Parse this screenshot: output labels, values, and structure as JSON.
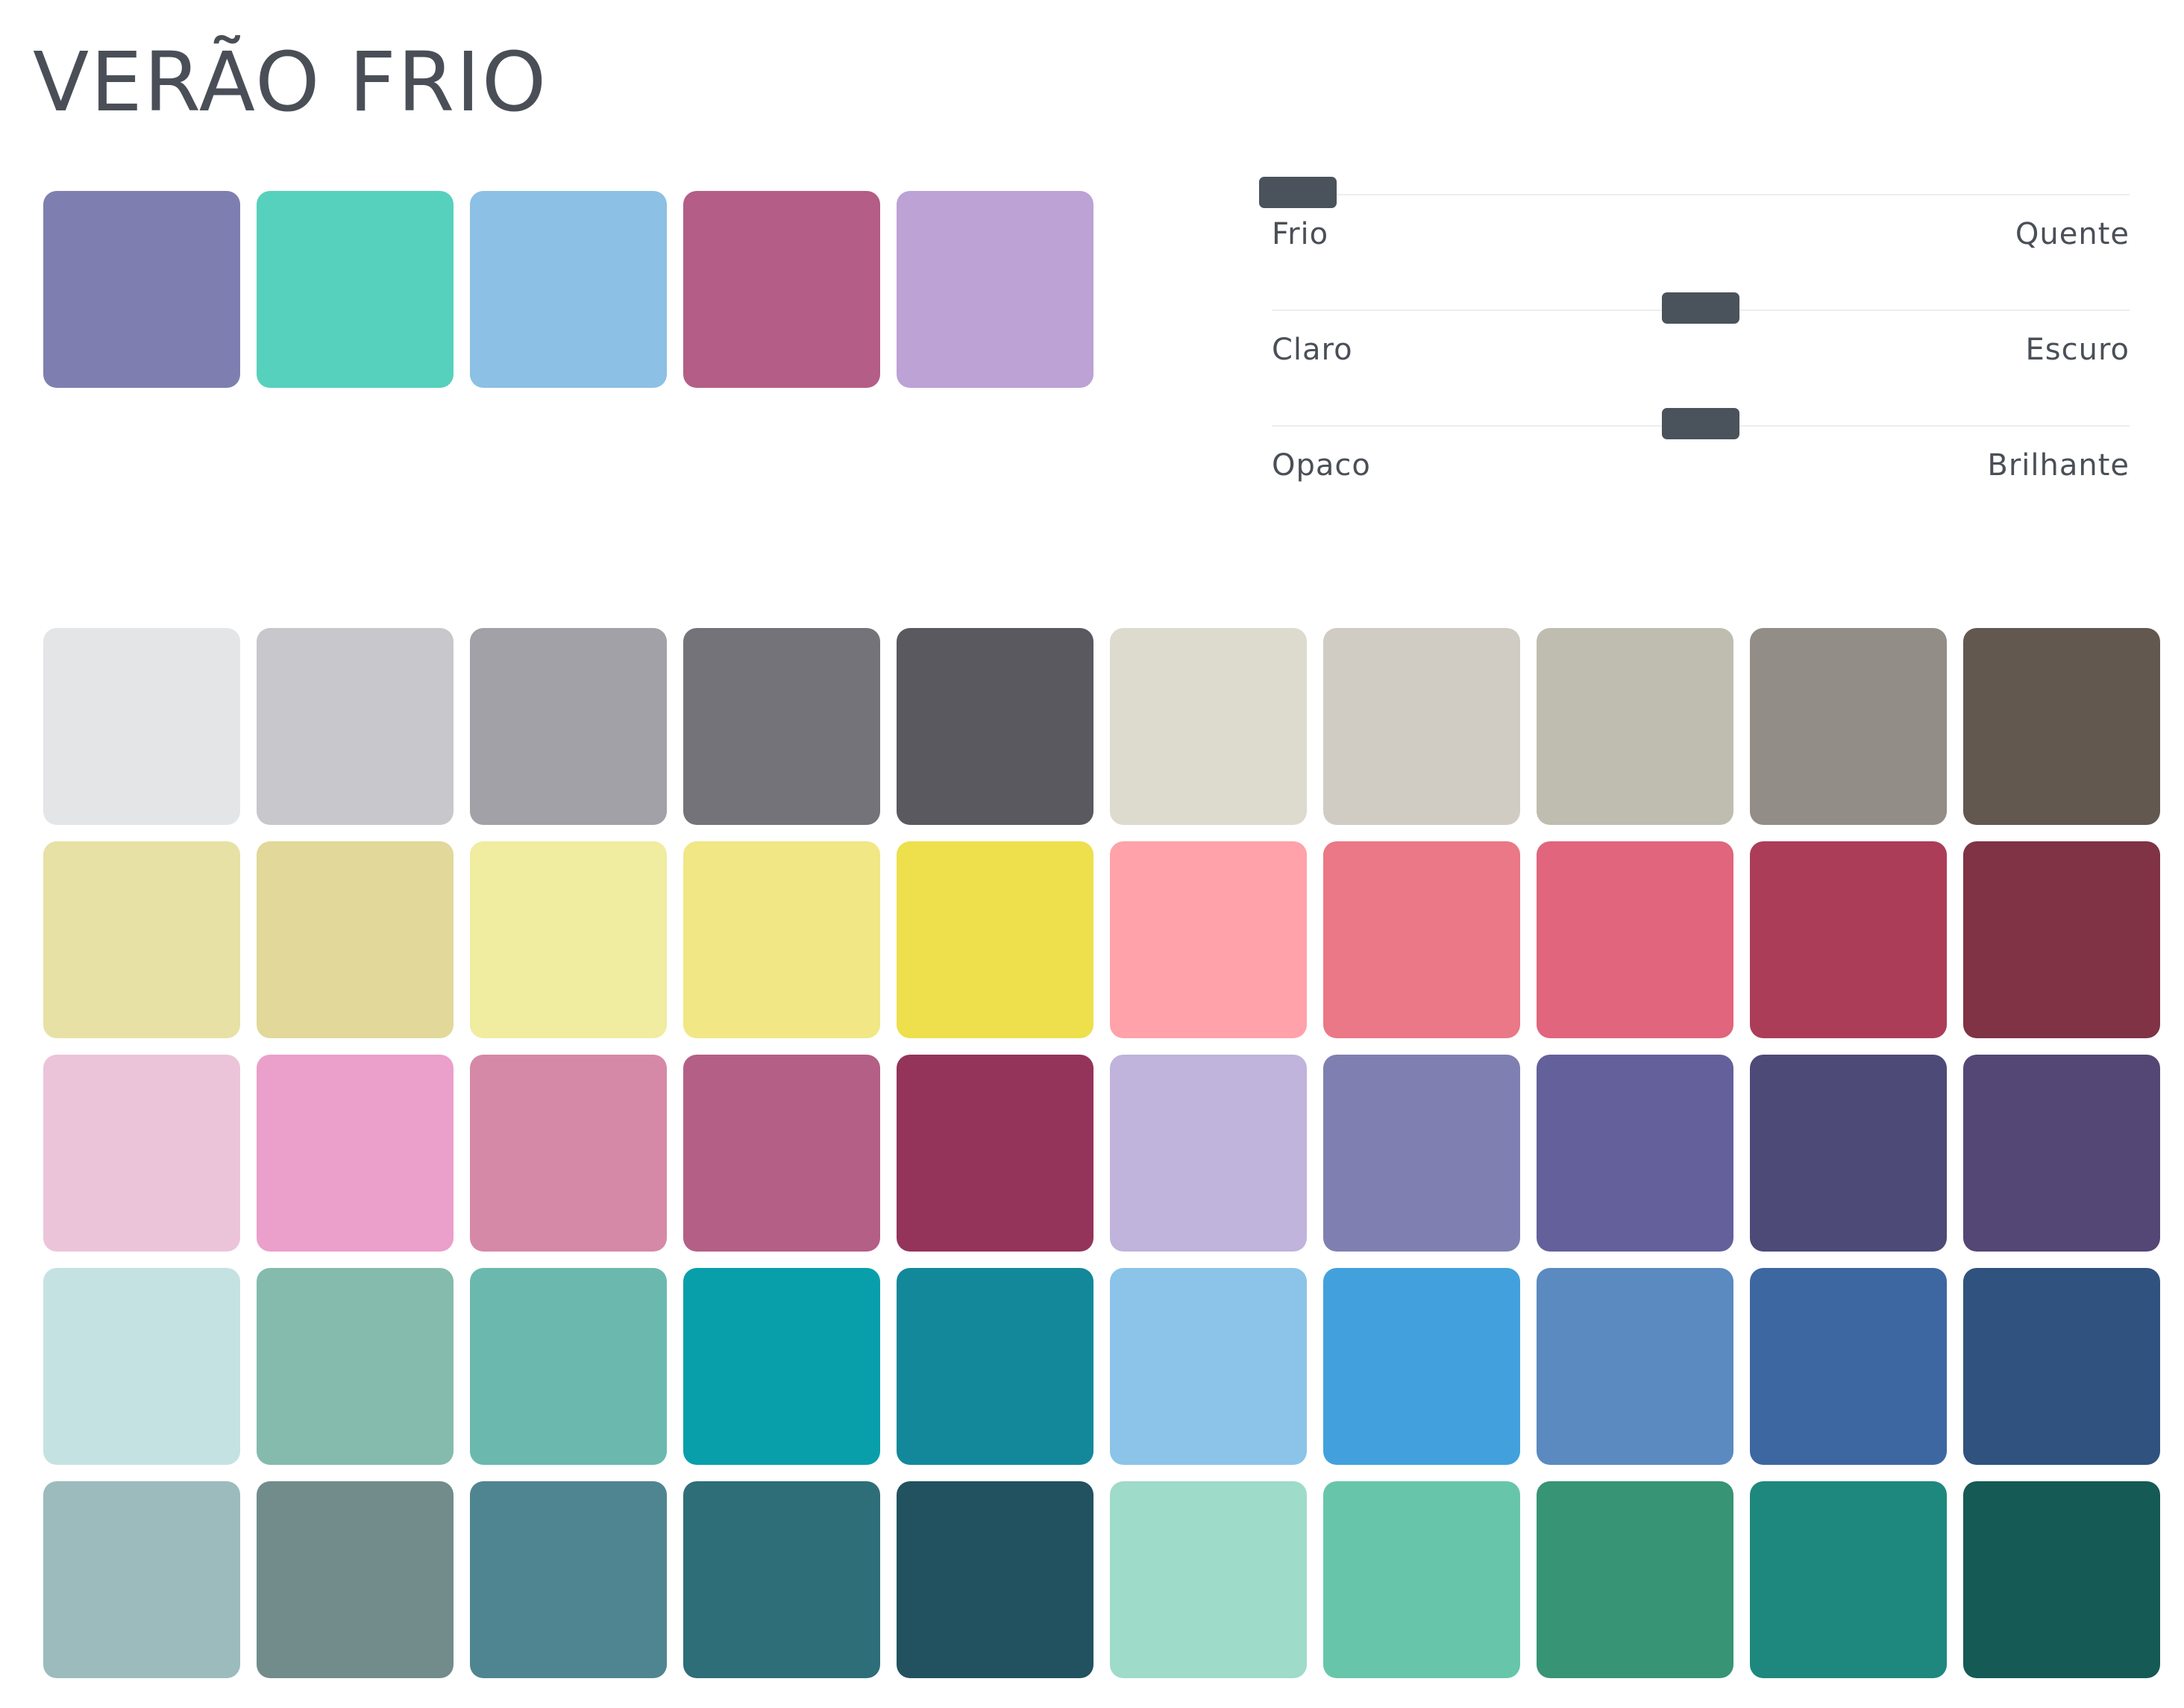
{
  "title": "VERÃO FRIO",
  "featured_colors": [
    "#7e7fb0",
    "#56d1bd",
    "#8cc0e4",
    "#b45d86",
    "#bca2d5"
  ],
  "sliders": [
    {
      "left_label": "Frio",
      "right_label": "Quente",
      "value": 0.03
    },
    {
      "left_label": "Claro",
      "right_label": "Escuro",
      "value": 0.5
    },
    {
      "left_label": "Opaco",
      "right_label": "Brilhante",
      "value": 0.5
    }
  ],
  "palette": [
    [
      "#e4e5e7",
      "#c7c7cc",
      "#a1a1a7",
      "#747379",
      "#5a595f",
      "#dddbce",
      "#d0ccc4",
      "#bfbdb0",
      "#928d86",
      "#625850"
    ],
    [
      "#e8e1a5",
      "#e1d89a",
      "#f0eca0",
      "#f1e785",
      "#ede04c",
      "#ffa2a9",
      "#ea7886",
      "#e0657d",
      "#ab3d59",
      "#7f3345"
    ],
    [
      "#ecc4da",
      "#eb9fcb",
      "#d589a7",
      "#b45f86",
      "#94345b",
      "#c0b3dc",
      "#7f80b1",
      "#64609b",
      "#4d4a78",
      "#544776"
    ],
    [
      "#c5e2e2",
      "#84bbad",
      "#6bb9ae",
      "#089fab",
      "#13889b",
      "#8bc4e8",
      "#42a1dc",
      "#5b8ac0",
      "#3d67a0",
      "#30527e"
    ],
    [
      "#9cbbbd",
      "#718c8b",
      "#4f8591",
      "#2e6e79",
      "#22525f",
      "#9edbc9",
      "#67c6aa",
      "#379475",
      "#1e887e",
      "#155a55"
    ]
  ]
}
